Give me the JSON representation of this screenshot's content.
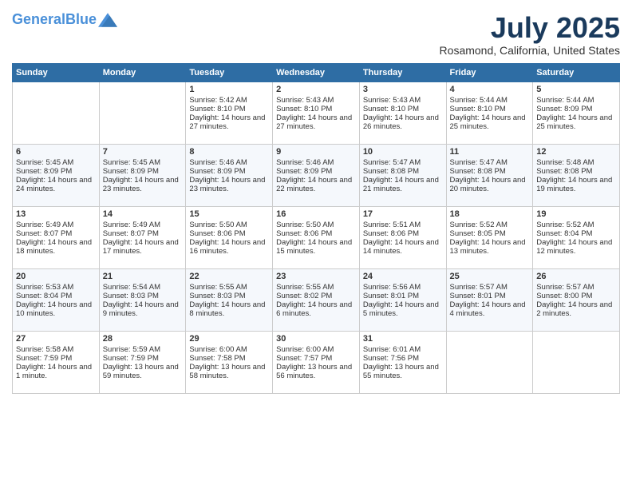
{
  "header": {
    "logo_line1": "General",
    "logo_line2": "Blue",
    "title": "July 2025",
    "subtitle": "Rosamond, California, United States"
  },
  "days_of_week": [
    "Sunday",
    "Monday",
    "Tuesday",
    "Wednesday",
    "Thursday",
    "Friday",
    "Saturday"
  ],
  "weeks": [
    [
      {
        "day": "",
        "content": ""
      },
      {
        "day": "",
        "content": ""
      },
      {
        "day": "1",
        "content": "Sunrise: 5:42 AM\nSunset: 8:10 PM\nDaylight: 14 hours and 27 minutes."
      },
      {
        "day": "2",
        "content": "Sunrise: 5:43 AM\nSunset: 8:10 PM\nDaylight: 14 hours and 27 minutes."
      },
      {
        "day": "3",
        "content": "Sunrise: 5:43 AM\nSunset: 8:10 PM\nDaylight: 14 hours and 26 minutes."
      },
      {
        "day": "4",
        "content": "Sunrise: 5:44 AM\nSunset: 8:10 PM\nDaylight: 14 hours and 25 minutes."
      },
      {
        "day": "5",
        "content": "Sunrise: 5:44 AM\nSunset: 8:09 PM\nDaylight: 14 hours and 25 minutes."
      }
    ],
    [
      {
        "day": "6",
        "content": "Sunrise: 5:45 AM\nSunset: 8:09 PM\nDaylight: 14 hours and 24 minutes."
      },
      {
        "day": "7",
        "content": "Sunrise: 5:45 AM\nSunset: 8:09 PM\nDaylight: 14 hours and 23 minutes."
      },
      {
        "day": "8",
        "content": "Sunrise: 5:46 AM\nSunset: 8:09 PM\nDaylight: 14 hours and 23 minutes."
      },
      {
        "day": "9",
        "content": "Sunrise: 5:46 AM\nSunset: 8:09 PM\nDaylight: 14 hours and 22 minutes."
      },
      {
        "day": "10",
        "content": "Sunrise: 5:47 AM\nSunset: 8:08 PM\nDaylight: 14 hours and 21 minutes."
      },
      {
        "day": "11",
        "content": "Sunrise: 5:47 AM\nSunset: 8:08 PM\nDaylight: 14 hours and 20 minutes."
      },
      {
        "day": "12",
        "content": "Sunrise: 5:48 AM\nSunset: 8:08 PM\nDaylight: 14 hours and 19 minutes."
      }
    ],
    [
      {
        "day": "13",
        "content": "Sunrise: 5:49 AM\nSunset: 8:07 PM\nDaylight: 14 hours and 18 minutes."
      },
      {
        "day": "14",
        "content": "Sunrise: 5:49 AM\nSunset: 8:07 PM\nDaylight: 14 hours and 17 minutes."
      },
      {
        "day": "15",
        "content": "Sunrise: 5:50 AM\nSunset: 8:06 PM\nDaylight: 14 hours and 16 minutes."
      },
      {
        "day": "16",
        "content": "Sunrise: 5:50 AM\nSunset: 8:06 PM\nDaylight: 14 hours and 15 minutes."
      },
      {
        "day": "17",
        "content": "Sunrise: 5:51 AM\nSunset: 8:06 PM\nDaylight: 14 hours and 14 minutes."
      },
      {
        "day": "18",
        "content": "Sunrise: 5:52 AM\nSunset: 8:05 PM\nDaylight: 14 hours and 13 minutes."
      },
      {
        "day": "19",
        "content": "Sunrise: 5:52 AM\nSunset: 8:04 PM\nDaylight: 14 hours and 12 minutes."
      }
    ],
    [
      {
        "day": "20",
        "content": "Sunrise: 5:53 AM\nSunset: 8:04 PM\nDaylight: 14 hours and 10 minutes."
      },
      {
        "day": "21",
        "content": "Sunrise: 5:54 AM\nSunset: 8:03 PM\nDaylight: 14 hours and 9 minutes."
      },
      {
        "day": "22",
        "content": "Sunrise: 5:55 AM\nSunset: 8:03 PM\nDaylight: 14 hours and 8 minutes."
      },
      {
        "day": "23",
        "content": "Sunrise: 5:55 AM\nSunset: 8:02 PM\nDaylight: 14 hours and 6 minutes."
      },
      {
        "day": "24",
        "content": "Sunrise: 5:56 AM\nSunset: 8:01 PM\nDaylight: 14 hours and 5 minutes."
      },
      {
        "day": "25",
        "content": "Sunrise: 5:57 AM\nSunset: 8:01 PM\nDaylight: 14 hours and 4 minutes."
      },
      {
        "day": "26",
        "content": "Sunrise: 5:57 AM\nSunset: 8:00 PM\nDaylight: 14 hours and 2 minutes."
      }
    ],
    [
      {
        "day": "27",
        "content": "Sunrise: 5:58 AM\nSunset: 7:59 PM\nDaylight: 14 hours and 1 minute."
      },
      {
        "day": "28",
        "content": "Sunrise: 5:59 AM\nSunset: 7:59 PM\nDaylight: 13 hours and 59 minutes."
      },
      {
        "day": "29",
        "content": "Sunrise: 6:00 AM\nSunset: 7:58 PM\nDaylight: 13 hours and 58 minutes."
      },
      {
        "day": "30",
        "content": "Sunrise: 6:00 AM\nSunset: 7:57 PM\nDaylight: 13 hours and 56 minutes."
      },
      {
        "day": "31",
        "content": "Sunrise: 6:01 AM\nSunset: 7:56 PM\nDaylight: 13 hours and 55 minutes."
      },
      {
        "day": "",
        "content": ""
      },
      {
        "day": "",
        "content": ""
      }
    ]
  ]
}
